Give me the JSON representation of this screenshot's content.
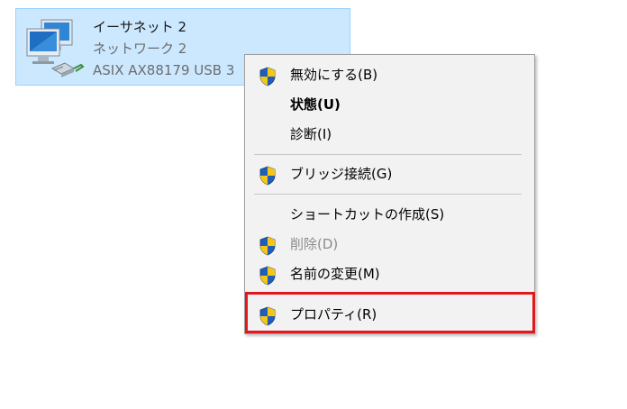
{
  "adapter": {
    "name": "イーサネット 2",
    "network": "ネットワーク 2",
    "device": "ASIX AX88179 USB 3"
  },
  "menu": {
    "items": [
      {
        "label": "無効にする(B)",
        "icon": "uac-shield-icon",
        "style": "normal"
      },
      {
        "label": "状態(U)",
        "icon": "",
        "style": "bold"
      },
      {
        "label": "診断(I)",
        "icon": "",
        "style": "normal"
      },
      {
        "label": "ブリッジ接続(G)",
        "icon": "uac-shield-icon",
        "style": "normal"
      },
      {
        "label": "ショートカットの作成(S)",
        "icon": "",
        "style": "normal"
      },
      {
        "label": "削除(D)",
        "icon": "uac-shield-icon",
        "style": "disabled"
      },
      {
        "label": "名前の変更(M)",
        "icon": "uac-shield-icon",
        "style": "normal"
      },
      {
        "label": "プロパティ(R)",
        "icon": "uac-shield-icon",
        "style": "normal"
      }
    ]
  },
  "colors": {
    "selection_bg": "#cce8ff",
    "menu_bg": "#f2f2f2",
    "highlight_border": "#e0191f",
    "shield_blue": "#1f5fb8",
    "shield_yellow": "#f5c518"
  }
}
